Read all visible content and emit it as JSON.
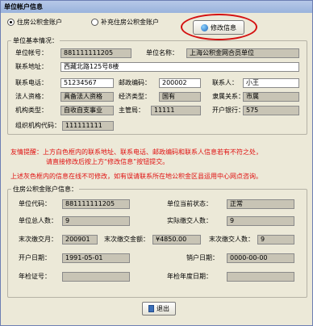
{
  "window": {
    "title": "单位帐户信息"
  },
  "account_type": {
    "option1": "住房公积金账户",
    "option2": "补充住房公积金账户",
    "selected": "option1"
  },
  "edit_button": {
    "label": "修改信息",
    "icon": "globe-icon"
  },
  "basic_info": {
    "legend": "单位基本情况：",
    "unit_account_label": "单位帐号：",
    "unit_account": "881111111205",
    "unit_name_label": "单位名称：",
    "unit_name": "上海公积金网合员单位",
    "address_label": "联系地址：",
    "address": "西藏北路125号8楼",
    "phone_label": "联系电话：",
    "phone": "51234567",
    "postcode_label": "邮政编码：",
    "postcode": "200002",
    "contact_label": "联系人：",
    "contact": "小王",
    "legal_label": "法人资格：",
    "legal": "具备法人资格",
    "econ_label": "经济类型：",
    "econ": "国有",
    "affil_label": "隶属关系：",
    "affil": "市属",
    "org_type_label": "机构类型：",
    "org_type": "自收自支事业",
    "dept_label": "主管局：",
    "dept": "11111",
    "bank_label": "开户银行：",
    "bank": "575",
    "org_code_label": "组织机构代码：",
    "org_code": "111111111"
  },
  "notices": {
    "line1": "友情提醒：上方白色框内的联系地址、联系电话、邮政编码和联系人信息若有不符之处，",
    "line2": "请直接修改后按上方“修改信息”按钮提交。",
    "line3": "上述灰色框内的信息在线不可修改，如有误请联系所在地公积金区县运用中心网点咨询。"
  },
  "fund_info": {
    "legend": "住房公积金账户信息：",
    "unit_code_label": "单位代码：",
    "unit_code": "881111111205",
    "status_label": "单位当前状态：",
    "status": "正常",
    "total_label": "单位总人数：",
    "total": "9",
    "actual_label": "实际缴交人数：",
    "actual": "9",
    "last_month_label": "末次缴交月：",
    "last_month": "200901",
    "last_amount_label": "末次缴交金额：",
    "last_amount": "¥4850.00",
    "last_count_label": "末次缴交人数：",
    "last_count": "9",
    "open_date_label": "开户日期：",
    "open_date": "1991-05-01",
    "close_date_label": "销户日期：",
    "close_date": "0000-00-00",
    "annual_cert_label": "年检证号：",
    "annual_cert": "",
    "annual_year_label": "年检年度日期：",
    "annual_year": ""
  },
  "exit_button": {
    "label": "退出",
    "icon": "exit-door-icon"
  }
}
